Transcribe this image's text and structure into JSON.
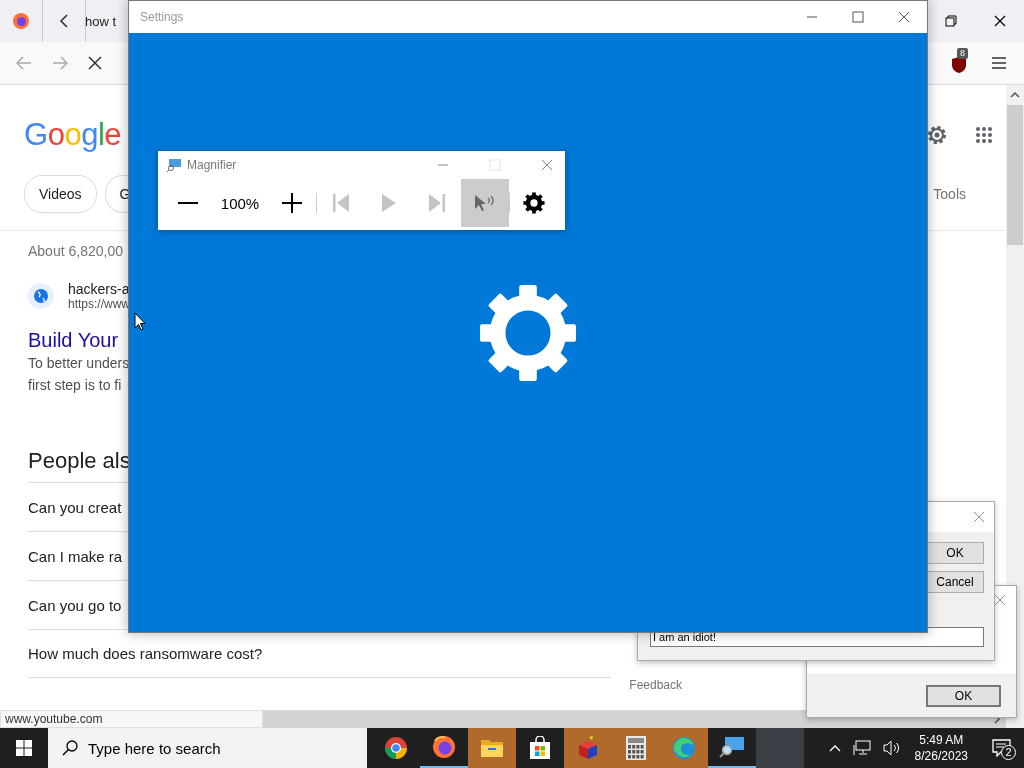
{
  "browser": {
    "tab": {
      "title": "how t"
    },
    "extension_badge": "8",
    "google": {
      "logo": "Google",
      "chips": [
        {
          "label": "Videos"
        },
        {
          "label": "G"
        }
      ],
      "tools": "Tools",
      "result_stats": "About 6,820,00",
      "result": {
        "site": "hackers-a",
        "url": "https://www",
        "title": "Build Your",
        "snippet": [
          "To better unders",
          "first step is to fi"
        ]
      },
      "people_also_ask": {
        "heading": "People als",
        "questions": [
          "Can you creat",
          "Can I make ra",
          "Can you go to",
          "How much does ransomware cost?"
        ]
      },
      "feedback": "Feedback"
    },
    "status_url": "www.youtube.com"
  },
  "settings_window": {
    "title": "Settings"
  },
  "magnifier": {
    "title": "Magnifier",
    "zoom": "100%",
    "tools": [
      {
        "kind": "previous",
        "disabled": true,
        "selected": false
      },
      {
        "kind": "play",
        "disabled": true,
        "selected": false
      },
      {
        "kind": "next",
        "disabled": true,
        "selected": false
      },
      {
        "kind": "read-from-pointer",
        "disabled": false,
        "selected": true
      }
    ]
  },
  "dialogs": [
    {
      "buttons": [
        "OK",
        "Cancel"
      ],
      "input_value": "I am an idiot!"
    },
    {
      "buttons": [
        "OK"
      ]
    }
  ],
  "taskbar": {
    "search_placeholder": "Type here to search",
    "apps": [
      {
        "kind": "chrome",
        "running": false,
        "flashing": false,
        "selected": false
      },
      {
        "kind": "firefox",
        "running": true,
        "flashing": false,
        "selected": false
      },
      {
        "kind": "folder",
        "running": false,
        "flashing": true,
        "selected": false
      },
      {
        "kind": "store",
        "running": false,
        "flashing": false,
        "selected": false
      },
      {
        "kind": "cube",
        "running": false,
        "flashing": true,
        "selected": false
      },
      {
        "kind": "calculator",
        "running": false,
        "flashing": true,
        "selected": false
      },
      {
        "kind": "edge",
        "running": false,
        "flashing": true,
        "selected": false
      },
      {
        "kind": "magnifier",
        "running": true,
        "flashing": false,
        "selected": false
      },
      {
        "kind": "window",
        "running": false,
        "flashing": false,
        "selected": true
      }
    ],
    "time": "5:49 AM",
    "date": "8/26/2023",
    "notifications": "2"
  }
}
